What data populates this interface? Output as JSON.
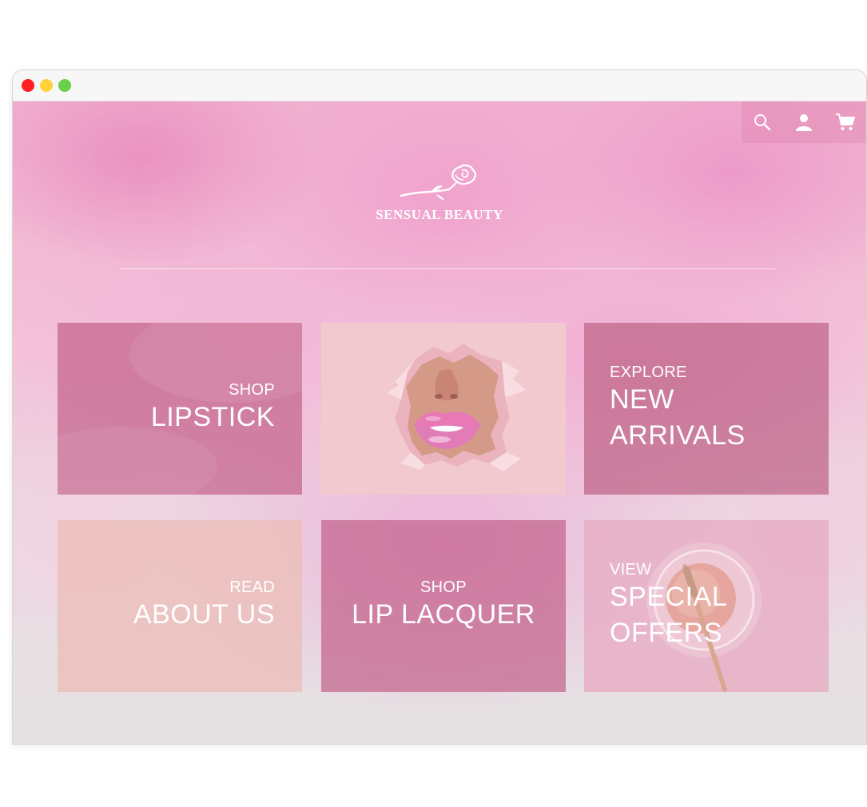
{
  "header": {
    "icons": [
      "search-icon",
      "user-icon",
      "cart-icon"
    ]
  },
  "brand": {
    "name": "SENSUAL BEAUTY"
  },
  "tiles": [
    {
      "small": "SHOP",
      "big": "LIPSTICK"
    },
    {
      "image": "torn-paper-lips-photo"
    },
    {
      "small": "EXPLORE",
      "big_line1": "NEW",
      "big_line2": "ARRIVALS"
    },
    {
      "small": "READ",
      "big": "ABOUT US"
    },
    {
      "small": "SHOP",
      "big": "LIP LACQUER"
    },
    {
      "small": "VIEW",
      "big_line1": "SPECIAL",
      "big_line2": "OFFERS"
    }
  ],
  "colors": {
    "tile_rose": "#c4648c",
    "tile_peach": "#ecbeb9",
    "tile_pink": "#e8afc6",
    "text": "#ffffff"
  }
}
